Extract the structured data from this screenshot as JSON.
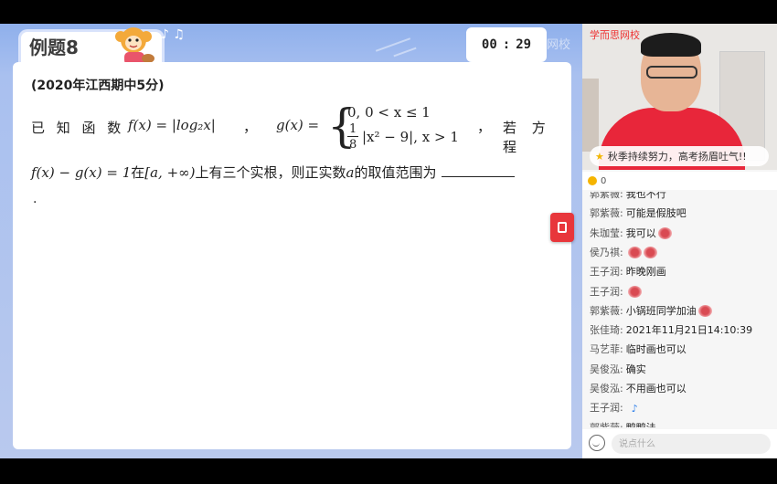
{
  "lesson": {
    "title": "例题8",
    "timer": {
      "minutes": "00",
      "seconds": "29"
    },
    "brand_faint": "网校",
    "question": {
      "source": "(2020年江西期中5分)",
      "intro": "已 知 函 数",
      "f_def": "f(x) = |log₂x|",
      "g_label": "g(x) =",
      "g_case1": "0, 0 < x ≤ 1",
      "g_case2_frac_num": "1",
      "g_case2_frac_den": "8",
      "g_case2_rest": "|x² − 9|, x > 1",
      "sep": "，",
      "tail": "若 方 程",
      "line2_eq": "f(x) − g(x) = 1",
      "line2_mid": "在",
      "line2_interval": "[a, +∞)",
      "line2_rest": "上有三个实根，则正实数",
      "line2_var": "a",
      "line2_end": "的取值范围为",
      "period": "."
    }
  },
  "video": {
    "brand": "学而思网校",
    "banner": "秋季持续努力，高考扬眉吐气!!"
  },
  "likes": {
    "count": "0"
  },
  "chat": [
    {
      "user": "郭紫薇:",
      "text": "我也不行",
      "emoji": 0
    },
    {
      "user": "郭紫薇:",
      "text": "可能是假肢吧",
      "emoji": 0
    },
    {
      "user": "朱珈莹:",
      "text": "我可以",
      "emoji": 1
    },
    {
      "user": "侯乃祺:",
      "text": "",
      "emoji": 2
    },
    {
      "user": "王子润:",
      "text": "昨晚刚画",
      "emoji": 0
    },
    {
      "user": "王子润:",
      "text": "",
      "emoji": 1
    },
    {
      "user": "郭紫薇:",
      "text": "小锅班同学加油",
      "emoji": 1
    },
    {
      "user": "张佳琦:",
      "text": "2021年11月21日14:10:39",
      "emoji": 0
    },
    {
      "user": "马艺菲:",
      "text": "临时画也可以",
      "emoji": 0
    },
    {
      "user": "吴俊泓:",
      "text": "确实",
      "emoji": 0
    },
    {
      "user": "吴俊泓:",
      "text": "不用画也可以",
      "emoji": 0
    },
    {
      "user": "王子润:",
      "text": "",
      "emoji": 0
    },
    {
      "user": "郭紫薇:",
      "text": "鸭鸭法",
      "emoji": 0
    }
  ],
  "input": {
    "placeholder": "说点什么"
  },
  "colors": {
    "accent": "#e8363b",
    "lesson_bg": "#a9c0ef"
  }
}
